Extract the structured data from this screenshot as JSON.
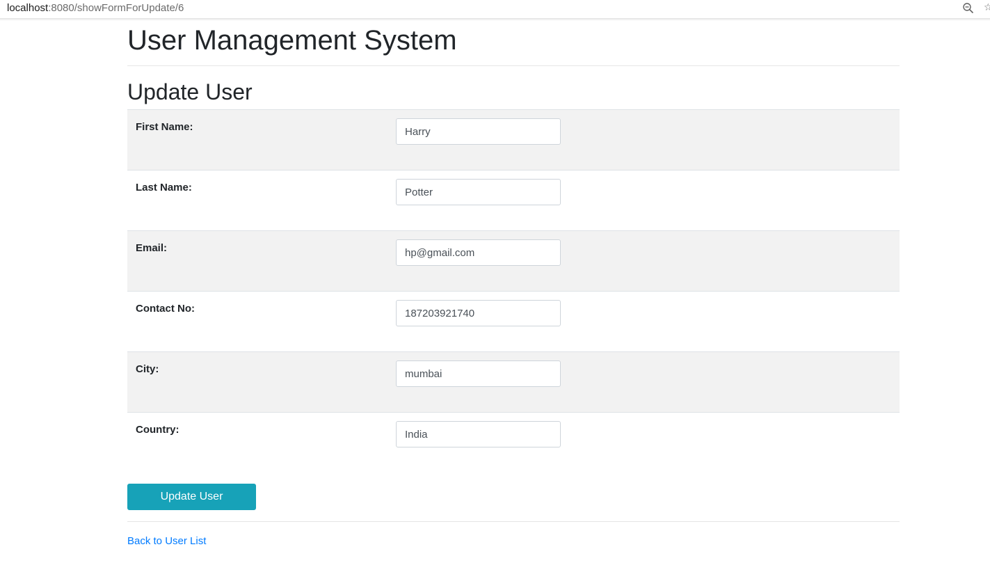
{
  "browser": {
    "url_host": "localhost",
    "url_rest": ":8080/showFormForUpdate/6",
    "zoom_icon": "magnifier-minus-icon"
  },
  "page": {
    "app_title": "User Management System",
    "form_title": "Update User"
  },
  "form": {
    "fields": [
      {
        "label": "First Name:",
        "value": "Harry"
      },
      {
        "label": "Last Name:",
        "value": "Potter"
      },
      {
        "label": "Email:",
        "value": "hp@gmail.com"
      },
      {
        "label": "Contact No:",
        "value": "187203921740"
      },
      {
        "label": "City:",
        "value": "mumbai"
      },
      {
        "label": "Country:",
        "value": "India"
      }
    ],
    "submit_label": "Update User"
  },
  "links": {
    "back": "Back to User List"
  },
  "colors": {
    "button_bg": "#17a2b8",
    "link": "#007bff",
    "stripe": "#f2f2f2"
  }
}
